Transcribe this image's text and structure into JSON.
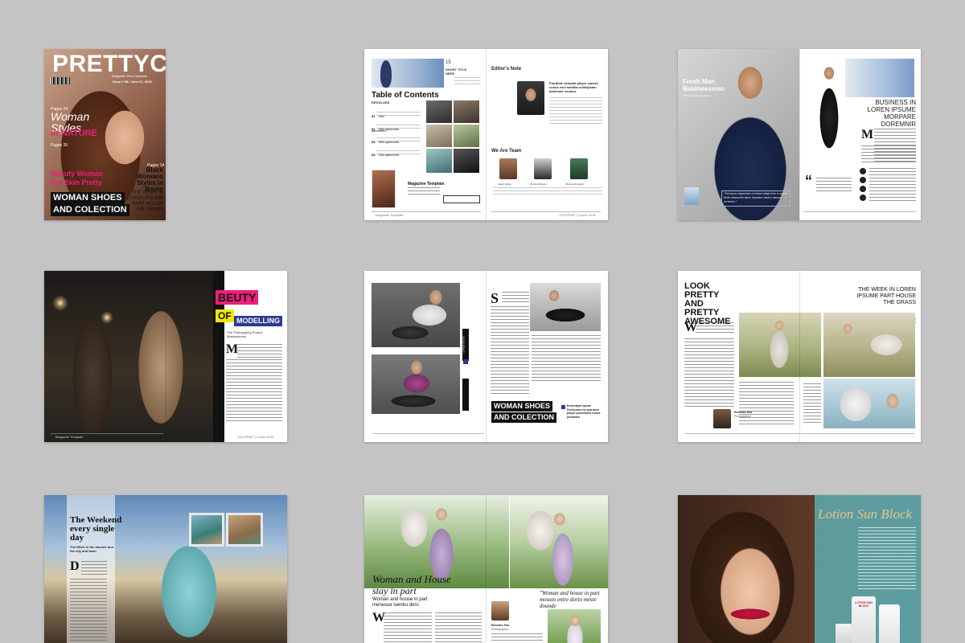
{
  "cover": {
    "masthead": "PRETTYCA",
    "tagline": "Magazine Print Template",
    "issue": "Issue # 08 / June 21, 2015",
    "page_ref_1": "Pages 24",
    "headline_1": "Woman Styles",
    "headline_1b": "in NATURE",
    "page_ref_2": "Pages 26",
    "headline_2": "Beauty Woman",
    "headline_2b": "For Skin Pretty",
    "page_ref_3": "Pages 14",
    "headline_3": "Black Womans Styles in Room",
    "headline_4": "THE WEEK IN LOREN IPSUME PART HOUSE THE GRASS",
    "banner_1": "WOMAN SHOES",
    "banner_2": "AND COLECTION"
  },
  "toc_spread": {
    "page_number": "15",
    "short_title": "SHORT TITLE HERE",
    "title": "Table of Contents",
    "regulars": "REGULARS",
    "items": [
      "01",
      "02",
      "03",
      "04"
    ],
    "item_label": "Wel spricnorm",
    "magazine_label": "Magazine Template",
    "editor_heading": "Editor's Note",
    "editor_quote": "Plurbibie deleptia plique saenee conus esci sandita vollicipsam aolennier eectom.",
    "team_heading": "We Are Team",
    "team_names": [
      "Jason Stone",
      "Jhonna Shance",
      "Jhonna Anoglosh"
    ],
    "footer_left": "Magazine Template",
    "footer_right": "TDA PRINT | Lorem 2015"
  },
  "fashion_spread": {
    "kicker": "Fresh Man Businessman",
    "kicker_sub": "\"Fresh Man Businessman.\"",
    "quote": "\"Hermmo etpacme a iment adipt ime a agem ficitt ndanuolo dum reprane domo amore emeren.\"",
    "headline": "BUSINESS IN LOREN IPSUME MORPARE DOREMNIR",
    "dropcap": "M"
  },
  "beauty_spread": {
    "word_1": "BEUTY",
    "word_2": "OF",
    "word_3": "MODELLING",
    "sub": "The Photography Project,",
    "sub2": "Masterpieces",
    "dropcap": "M",
    "footer_left": "Magazine Template",
    "footer_right": "TDA PRINT | Lorem 2015"
  },
  "shoes_spread": {
    "dropcap": "S",
    "side_tag": "LOREM IPSUM",
    "banner_1": "WOMAN SHOES",
    "banner_2": "AND COLECTION",
    "caption": "Enchulipse ipsum Pentiumas vie qua-aneo poque posinhiono neque portanteo"
  },
  "awesome_spread": {
    "headline": "LOOK PRETTY AND PRETTY AWESOME",
    "dropcap": "W",
    "right_headline": "THE WEEK IN LOREN IPSUME PART HOUSE THE GRASS",
    "right_sub": "The firm mons kradiabin ozie gest ca",
    "author": "Remotes Soo",
    "author_role": "Photographer"
  },
  "weekend_spread": {
    "headline": "The Weekend every single day",
    "sub": "The Week in the musich tour the city and town",
    "dropcap": "D"
  },
  "house_spread": {
    "script_title": "Woman and House",
    "script_title2": "stay in part",
    "subtitle": "Woman and house in part menesue luenku doro",
    "dropcap": "W",
    "quote": "\"Woman and house in part mousto entre dorto meste dounde",
    "author": "Remotes Soo",
    "author_role": "Photographer"
  },
  "lotion_spread": {
    "title": "Lotion Sun Block",
    "product_label": "LOTION SUN BLOCK"
  },
  "colors": {
    "page_bg": "#c4c4c4",
    "pink": "#ec1e79",
    "navy": "#2b3a8f",
    "teal": "#5c9ea0",
    "black": "#111111"
  }
}
